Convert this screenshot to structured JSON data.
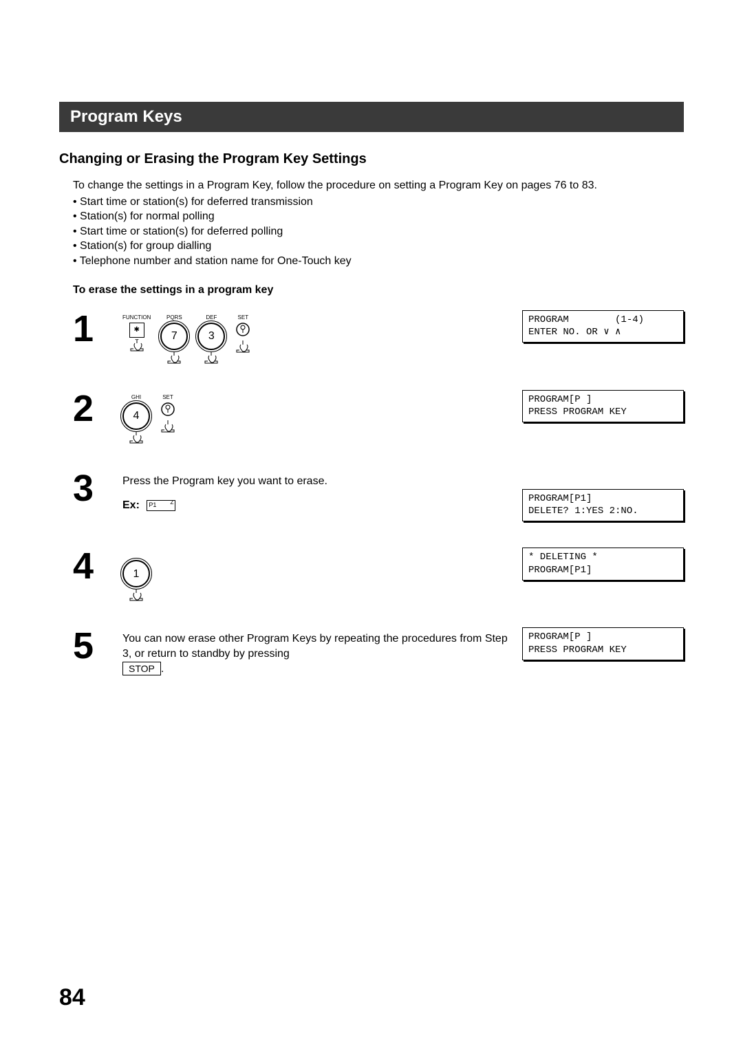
{
  "titleBar": "Program Keys",
  "subtitle": "Changing or Erasing the Program Key Settings",
  "intro": {
    "main": "To change the settings in a Program Key, follow the procedure on setting a Program Key on pages 76 to 83.",
    "bullets": [
      "• Start time or station(s) for deferred transmission",
      "• Station(s) for normal polling",
      "• Start time or station(s) for deferred polling",
      "• Station(s) for group dialling",
      "• Telephone number and station name for One-Touch key"
    ]
  },
  "subhead": "To erase the settings in a program key",
  "steps": {
    "s1": {
      "num": "1",
      "keys": {
        "function": "FUNCTION",
        "k7top": "PQRS",
        "k7": "7",
        "k3top": "DEF",
        "k3": "3",
        "set": "SET"
      },
      "display": "PROGRAM        (1-4)\nENTER NO. OR ∨ ∧"
    },
    "s2": {
      "num": "2",
      "keys": {
        "k4top": "GHI",
        "k4": "4",
        "set": "SET"
      },
      "display": "PROGRAM[P ]\nPRESS PROGRAM KEY"
    },
    "s3": {
      "num": "3",
      "text": "Press the Program key you want to erase.",
      "exLabel": "Ex:",
      "exKeyP1": "P1",
      "exKeyZ": "Z",
      "display": "PROGRAM[P1]\nDELETE? 1:YES 2:NO."
    },
    "s4": {
      "num": "4",
      "keys": {
        "k1": "1"
      },
      "display": "* DELETING *\nPROGRAM[P1]"
    },
    "s5": {
      "num": "5",
      "textA": "You can now erase other Program Keys by repeating the procedures from Step 3, or return to standby by pressing",
      "stop": "STOP",
      "textB": ".",
      "display": "PROGRAM[P ]\nPRESS PROGRAM KEY"
    }
  },
  "pageNum": "84"
}
